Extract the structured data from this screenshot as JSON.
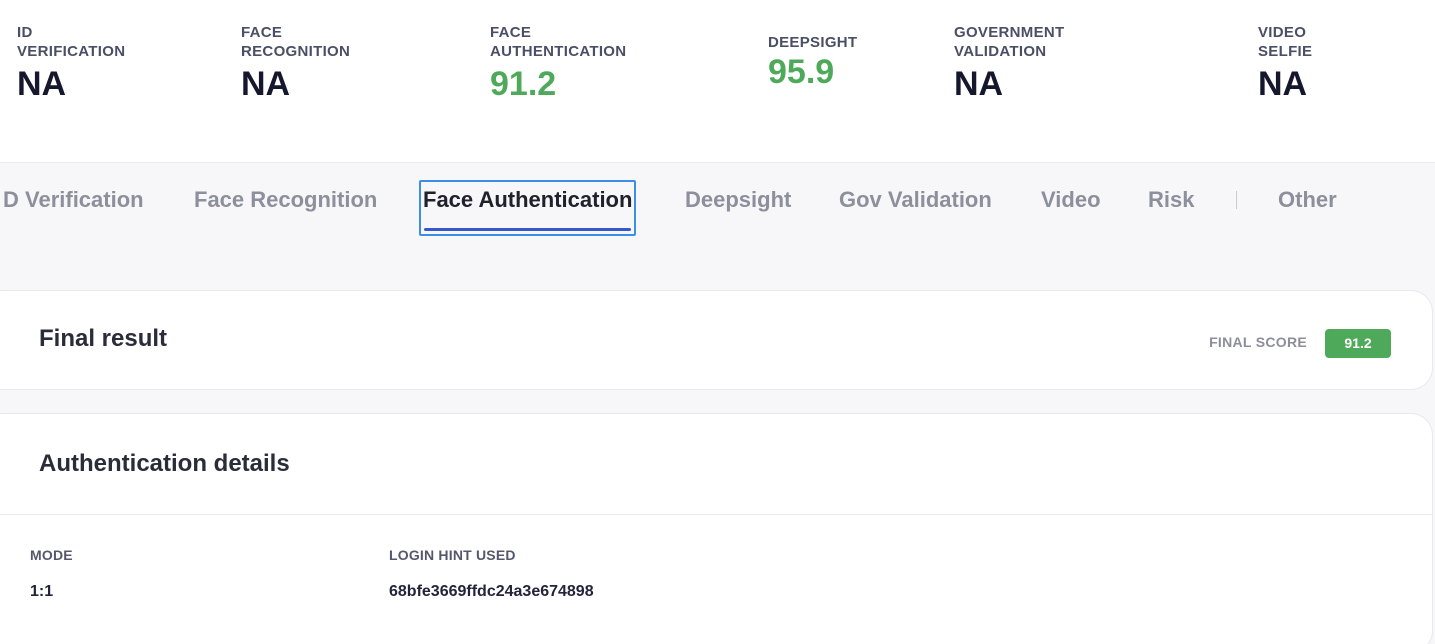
{
  "scores": [
    {
      "label_line1": "ID",
      "label_line2": "VERIFICATION",
      "value": "NA"
    },
    {
      "label_line1": "FACE",
      "label_line2": "RECOGNITION",
      "value": "NA"
    },
    {
      "label_line1": "FACE",
      "label_line2": "AUTHENTICATION",
      "value": "91.2"
    },
    {
      "label_line1": "DEEPSIGHT",
      "label_line2": "",
      "value": "95.9"
    },
    {
      "label_line1": "GOVERNMENT",
      "label_line2": "VALIDATION",
      "value": "NA"
    },
    {
      "label_line1": "VIDEO",
      "label_line2": "SELFIE",
      "value": "NA"
    }
  ],
  "tabs": [
    {
      "label": "D Verification"
    },
    {
      "label": "Face Recognition"
    },
    {
      "label": "Face Authentication",
      "active": true
    },
    {
      "label": "Deepsight"
    },
    {
      "label": "Gov Validation"
    },
    {
      "label": "Video"
    },
    {
      "label": "Risk"
    },
    {
      "label": "Other"
    }
  ],
  "final_result": {
    "title": "Final result",
    "score_label": "FINAL SCORE",
    "score_value": "91.2"
  },
  "details": {
    "title": "Authentication details",
    "mode_label": "MODE",
    "mode_value": "1:1",
    "hint_label": "LOGIN HINT USED",
    "hint_value": "68bfe3669ffdc24a3e674898"
  },
  "colors": {
    "accent_green": "#4fa95a",
    "focus_blue": "#3b8fe6"
  }
}
